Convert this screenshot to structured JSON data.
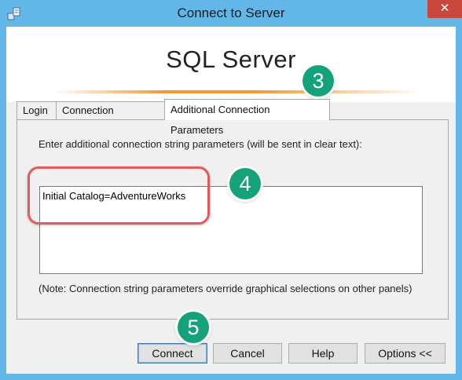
{
  "window": {
    "title": "Connect to Server",
    "close_glyph": "✕"
  },
  "banner": {
    "product_name": "SQL Server"
  },
  "tabs": [
    {
      "label": "Login"
    },
    {
      "label": "Connection Properties"
    },
    {
      "label": "Additional Connection Parameters",
      "active": true
    }
  ],
  "panel": {
    "instruction": "Enter additional connection string parameters (will be sent in clear text):",
    "connection_params_value": "Initial Catalog=AdventureWorks",
    "note": "(Note: Connection string parameters override graphical selections on other panels)"
  },
  "buttons": {
    "connect": "Connect",
    "cancel": "Cancel",
    "help": "Help",
    "options": "Options <<"
  },
  "annotations": {
    "step3": "3",
    "step4": "4",
    "step5": "5"
  },
  "colors": {
    "titlebar": "#62b6e8",
    "close_button": "#c9483b",
    "accent_stripe": "#f39a33",
    "step_badge": "#15a27a",
    "highlight_ring": "#e05b5b"
  },
  "icons": {
    "app": "server-connection-icon",
    "close": "close-icon"
  }
}
